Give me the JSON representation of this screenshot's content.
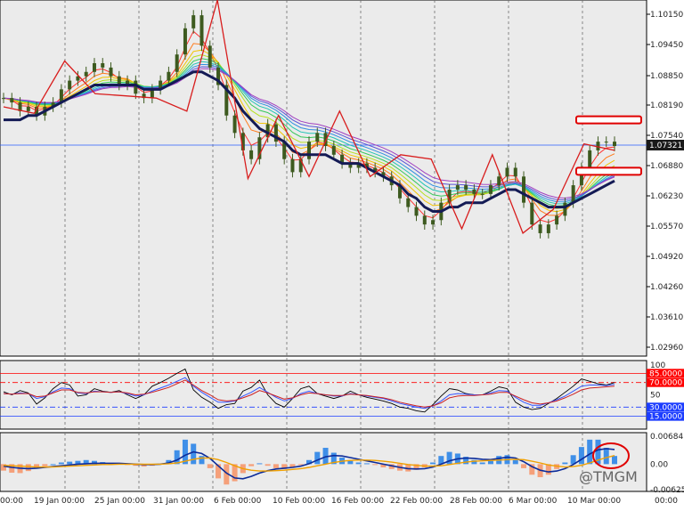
{
  "colors": {
    "background": "#ebebeb",
    "panel_border": "#000000",
    "grid": "#6e6e6e",
    "price_line": "#2a5cff",
    "price_tag_bg": "#1a1a1a",
    "price_tag_text": "#ffffff",
    "zigzag": "#d81d1d",
    "candle": "#3d5a1f",
    "ribbon": [
      "#ff3030",
      "#ff7a1a",
      "#f2c300",
      "#b6e020",
      "#36c85a",
      "#21c4b4",
      "#2f8fe0",
      "#5a55d8",
      "#a040c0"
    ],
    "slow_ma": "#141b55",
    "rsi_main": "#000000",
    "rsi_blue": "#3355ff",
    "rsi_red": "#cc2222",
    "level_red": "#ff0000",
    "level_blue": "#1c3dff",
    "macd_pos": "#3f8fe8",
    "macd_neg": "#f5a07a",
    "macd_line1": "#0c2b99",
    "macd_line2": "#f0a000",
    "highlight": "#e00000",
    "level_box_fill": "#ffffff"
  },
  "price_axis": {
    "ticks": [
      "1.10150",
      "1.09450",
      "1.08850",
      "1.08190",
      "1.07540",
      "1.06880",
      "1.06230",
      "1.05570",
      "1.04920",
      "1.04260",
      "1.03610",
      "1.02960"
    ],
    "current_price": "1.07321"
  },
  "rsi_axis": {
    "top_label": "100",
    "mid_label": "50",
    "levels": [
      {
        "label": "85.0000",
        "value": 85,
        "color": "#ff0000",
        "style": "solid"
      },
      {
        "label": "70.0000",
        "value": 70,
        "color": "#ff0000",
        "style": "dashdot"
      },
      {
        "label": "30.0000",
        "value": 30,
        "color": "#1c3dff",
        "style": "dashdot"
      },
      {
        "label": "15.0000",
        "value": 15,
        "color": "#1c3dff",
        "style": "solid"
      }
    ]
  },
  "macd_axis": {
    "ticks": [
      "0.0068477",
      "0.00",
      "-0.0062573"
    ]
  },
  "time_axis": {
    "labels": [
      "00:00",
      "19 Jan 00:00",
      "25 Jan 00:00",
      "31 Jan 00:00",
      "6 Feb 00:00",
      "10 Feb 00:00",
      "16 Feb 00:00",
      "22 Feb 00:00",
      "28 Feb 00:00",
      "6 Mar 00:00",
      "10 Mar 00:00",
      "00:00"
    ]
  },
  "watermark": "@TMGM",
  "chart_data": [
    {
      "type": "line",
      "title": "",
      "xlabel": "",
      "ylabel": "",
      "ylim": [
        1.0248,
        1.1065
      ],
      "grid": true,
      "x_labels": [
        "19 Jan 00:00",
        "25 Jan 00:00",
        "31 Jan 00:00",
        "6 Feb 00:00",
        "10 Feb 00:00",
        "16 Feb 00:00",
        "22 Feb 00:00",
        "28 Feb 00:00",
        "6 Mar 00:00",
        "10 Mar 00:00"
      ],
      "current_price": 1.07321,
      "series": [
        {
          "values": [
            1.084,
            1.083,
            1.081,
            1.082,
            1.08,
            1.082,
            1.083,
            1.086,
            1.088,
            1.089,
            1.09,
            1.092,
            1.091,
            1.089,
            1.087,
            1.088,
            1.085,
            1.084,
            1.086,
            1.088,
            1.09,
            1.094,
            1.1,
            1.103,
            1.096,
            1.091,
            1.087,
            1.08,
            1.076,
            1.072,
            1.07,
            1.075,
            1.078,
            1.074,
            1.07,
            1.067,
            1.07,
            1.074,
            1.076,
            1.073,
            1.071,
            1.069,
            1.068,
            1.069,
            1.068,
            1.067,
            1.066,
            1.064,
            1.061,
            1.059,
            1.057,
            1.055,
            1.056,
            1.06,
            1.063,
            1.064,
            1.063,
            1.062,
            1.062,
            1.064,
            1.066,
            1.068,
            1.066,
            1.06,
            1.055,
            1.053,
            1.055,
            1.057,
            1.06,
            1.064,
            1.068,
            1.072,
            1.074,
            1.074,
            1.073
          ]
        },
        {
          "values": [
            1.079,
            1.079,
            1.079,
            1.08,
            1.08,
            1.081,
            1.082,
            1.083,
            1.084,
            1.085,
            1.086,
            1.087,
            1.087,
            1.087,
            1.087,
            1.087,
            1.087,
            1.086,
            1.086,
            1.086,
            1.087,
            1.088,
            1.089,
            1.09,
            1.09,
            1.089,
            1.088,
            1.086,
            1.084,
            1.081,
            1.079,
            1.077,
            1.076,
            1.075,
            1.074,
            1.072,
            1.071,
            1.071,
            1.071,
            1.071,
            1.07,
            1.069,
            1.069,
            1.069,
            1.068,
            1.067,
            1.066,
            1.065,
            1.064,
            1.062,
            1.061,
            1.059,
            1.058,
            1.058,
            1.059,
            1.059,
            1.06,
            1.06,
            1.06,
            1.061,
            1.062,
            1.063,
            1.063,
            1.062,
            1.061,
            1.06,
            1.059,
            1.059,
            1.059,
            1.06,
            1.061,
            1.062,
            1.063,
            1.064,
            1.065
          ]
        }
      ],
      "zigzag": [
        1.082,
        1.0805,
        1.0925,
        1.085,
        1.0845,
        1.084,
        1.081,
        1.1065,
        1.0655,
        1.08,
        1.066,
        1.081,
        1.066,
        1.071,
        1.07,
        1.054,
        1.071,
        1.053,
        1.0585,
        1.0735,
        1.072
      ],
      "resistance_level": 1.079,
      "support_level": 1.0672
    },
    {
      "type": "line",
      "title": "",
      "ylim": [
        0,
        100
      ],
      "levels": [
        85,
        70,
        30,
        15
      ],
      "series": [
        {
          "values": [
            55,
            50,
            57,
            53,
            35,
            45,
            60,
            70,
            66,
            48,
            50,
            60,
            56,
            54,
            57,
            50,
            44,
            50,
            64,
            70,
            77,
            85,
            92,
            58,
            46,
            38,
            28,
            34,
            36,
            56,
            62,
            74,
            50,
            36,
            30,
            44,
            60,
            64,
            52,
            48,
            44,
            48,
            56,
            50,
            46,
            43,
            40,
            36,
            30,
            28,
            24,
            22,
            34,
            48,
            60,
            58,
            52,
            50,
            50,
            56,
            63,
            60,
            38,
            30,
            26,
            28,
            36,
            44,
            54,
            64,
            76,
            72,
            68,
            66,
            70
          ]
        },
        {
          "values": [
            52,
            51,
            53,
            52,
            44,
            47,
            55,
            61,
            60,
            53,
            52,
            56,
            55,
            54,
            55,
            52,
            48,
            50,
            56,
            61,
            66,
            72,
            78,
            64,
            54,
            46,
            38,
            38,
            40,
            48,
            54,
            62,
            54,
            46,
            40,
            44,
            52,
            56,
            52,
            50,
            48,
            48,
            52,
            50,
            48,
            46,
            44,
            40,
            36,
            33,
            30,
            28,
            32,
            40,
            50,
            52,
            51,
            50,
            50,
            53,
            57,
            56,
            46,
            38,
            33,
            33,
            37,
            42,
            48,
            56,
            64,
            66,
            66,
            65,
            67
          ]
        },
        {
          "values": [
            52,
            51,
            52,
            52,
            47,
            48,
            53,
            58,
            58,
            54,
            53,
            55,
            55,
            54,
            55,
            53,
            50,
            51,
            54,
            58,
            62,
            68,
            74,
            66,
            57,
            50,
            42,
            40,
            41,
            45,
            50,
            57,
            53,
            48,
            43,
            45,
            50,
            53,
            52,
            50,
            49,
            49,
            51,
            50,
            49,
            47,
            45,
            42,
            38,
            35,
            32,
            30,
            32,
            37,
            45,
            48,
            49,
            49,
            50,
            51,
            54,
            54,
            48,
            42,
            37,
            35,
            37,
            40,
            45,
            51,
            58,
            61,
            62,
            63,
            64
          ]
        }
      ]
    },
    {
      "type": "bar",
      "title": "",
      "ylim": [
        -0.0062573,
        0.0068477
      ],
      "values": [
        -0.0016,
        -0.0021,
        -0.0022,
        -0.0017,
        -0.001,
        -0.0005,
        0.0,
        0.0004,
        0.0006,
        0.0008,
        0.001,
        0.0008,
        0.0005,
        0.0003,
        0.0001,
        -0.0002,
        -0.0004,
        -0.0006,
        -0.0004,
        0.0001,
        0.001,
        0.0034,
        0.006,
        0.005,
        0.002,
        -0.001,
        -0.0035,
        -0.005,
        -0.0042,
        -0.0022,
        -0.0005,
        0.0002,
        -0.0004,
        -0.001,
        -0.0012,
        -0.0008,
        -0.0002,
        0.001,
        0.003,
        0.004,
        0.0028,
        0.0016,
        0.0008,
        0.0004,
        0.0002,
        -0.0002,
        -0.0008,
        -0.0012,
        -0.0016,
        -0.0018,
        -0.0014,
        -0.0008,
        0.0004,
        0.002,
        0.003,
        0.0026,
        0.0018,
        0.001,
        0.0004,
        0.0008,
        0.002,
        0.0022,
        0.001,
        -0.001,
        -0.0026,
        -0.0032,
        -0.0026,
        -0.0012,
        0.0004,
        0.0022,
        0.0042,
        0.006,
        0.006,
        0.004,
        0.002
      ],
      "series": [
        {
          "values": [
            -0.0005,
            -0.0008,
            -0.001,
            -0.0011,
            -0.001,
            -0.0008,
            -0.0006,
            -0.0004,
            -0.0002,
            0.0,
            0.0001,
            0.0002,
            0.0002,
            0.0002,
            0.0002,
            0.0001,
            0.0,
            -0.0001,
            -0.0001,
            0.0,
            0.0003,
            0.001,
            0.0022,
            0.003,
            0.0026,
            0.0014,
            -0.0004,
            -0.0022,
            -0.0034,
            -0.0036,
            -0.003,
            -0.0022,
            -0.0016,
            -0.0012,
            -0.001,
            -0.0008,
            -0.0005,
            0.0001,
            0.001,
            0.0018,
            0.0021,
            0.002,
            0.0016,
            0.0012,
            0.0008,
            0.0004,
            0.0,
            -0.0004,
            -0.0008,
            -0.0011,
            -0.0012,
            -0.0011,
            -0.0007,
            0.0,
            0.0008,
            0.0013,
            0.0015,
            0.0014,
            0.0012,
            0.0011,
            0.0014,
            0.0017,
            0.0015,
            0.0006,
            -0.0006,
            -0.0015,
            -0.0019,
            -0.0017,
            -0.0011,
            -0.0001,
            0.0012,
            0.0025,
            0.0035,
            0.0038,
            0.0036
          ]
        },
        {
          "values": [
            -0.0003,
            -0.0004,
            -0.0005,
            -0.0006,
            -0.0007,
            -0.0007,
            -0.0007,
            -0.0006,
            -0.0005,
            -0.0004,
            -0.0003,
            -0.0002,
            -0.0001,
            -0.0001,
            0.0,
            0.0,
            0.0,
            0.0,
            0.0,
            0.0,
            0.0001,
            0.0003,
            0.0007,
            0.0012,
            0.0015,
            0.0015,
            0.0011,
            0.0004,
            -0.0004,
            -0.0011,
            -0.0015,
            -0.0017,
            -0.0017,
            -0.0016,
            -0.0015,
            -0.0013,
            -0.0011,
            -0.0008,
            -0.0004,
            0.0,
            0.0004,
            0.0007,
            0.0009,
            0.001,
            0.001,
            0.0009,
            0.0007,
            0.0005,
            0.0002,
            -0.0001,
            -0.0003,
            -0.0005,
            -0.0005,
            -0.0004,
            -0.0001,
            0.0002,
            0.0005,
            0.0007,
            0.0008,
            0.0009,
            0.001,
            0.0011,
            0.0012,
            0.0011,
            0.0007,
            0.0003,
            -0.0002,
            -0.0005,
            -0.0007,
            -0.0006,
            -0.0003,
            0.0003,
            0.001,
            0.0016,
            0.0021
          ]
        }
      ]
    }
  ]
}
